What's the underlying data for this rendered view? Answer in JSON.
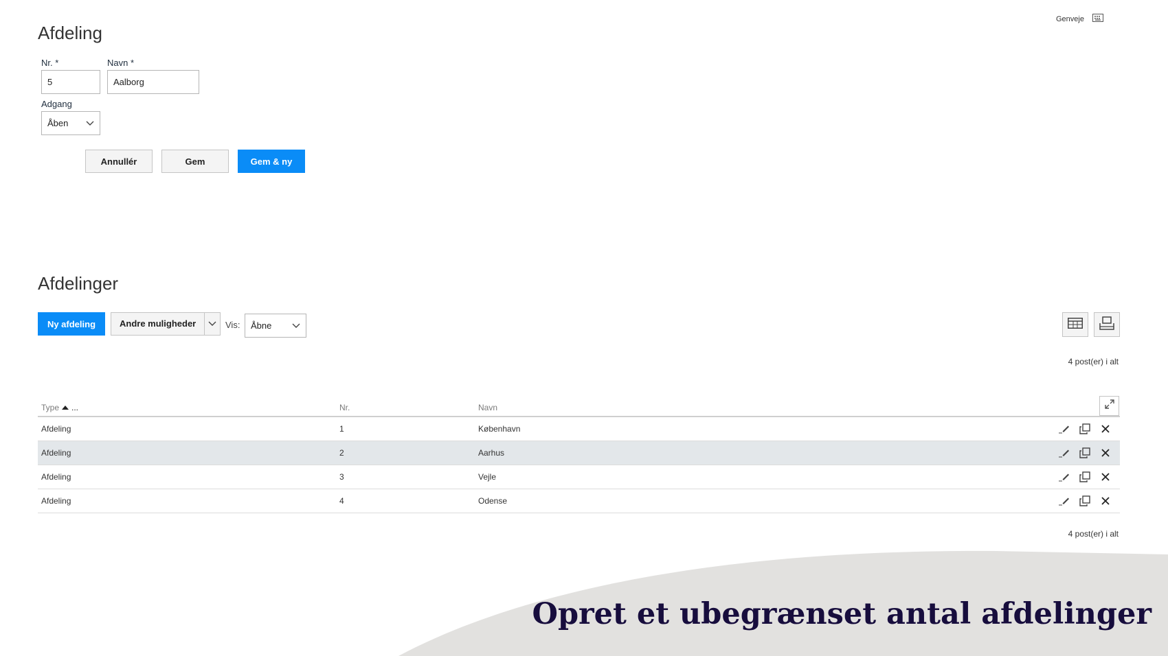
{
  "header": {
    "shortcut_label": "Genveje",
    "shortcut_icon": "keyboard-icon"
  },
  "form": {
    "title": "Afdeling",
    "nr_label": "Nr. *",
    "nr_value": "5",
    "navn_label": "Navn *",
    "navn_value": "Aalborg",
    "adgang_label": "Adgang",
    "adgang_value": "Åben",
    "buttons": {
      "cancel": "Annullér",
      "save": "Gem",
      "save_new": "Gem & ny"
    }
  },
  "list": {
    "title": "Afdelinger",
    "new_button": "Ny afdeling",
    "more_options": "Andre muligheder",
    "vis_label": "Vis:",
    "vis_value": "Åbne",
    "count_top": "4 post(er) i alt",
    "count_bottom": "4 post(er) i alt",
    "columns": {
      "type": "Type",
      "type_more": "...",
      "nr": "Nr.",
      "navn": "Navn"
    },
    "rows": [
      {
        "type": "Afdeling",
        "nr": "1",
        "navn": "København"
      },
      {
        "type": "Afdeling",
        "nr": "2",
        "navn": "Aarhus"
      },
      {
        "type": "Afdeling",
        "nr": "3",
        "navn": "Vejle"
      },
      {
        "type": "Afdeling",
        "nr": "4",
        "navn": "Odense"
      }
    ]
  },
  "banner": {
    "text": "Opret et ubegrænset antal afdelinger"
  },
  "colors": {
    "primary": "#0a8cf7",
    "banner_bg": "#e2e1df",
    "banner_text": "#170d3d",
    "row_highlight": "#e3e7ea"
  }
}
